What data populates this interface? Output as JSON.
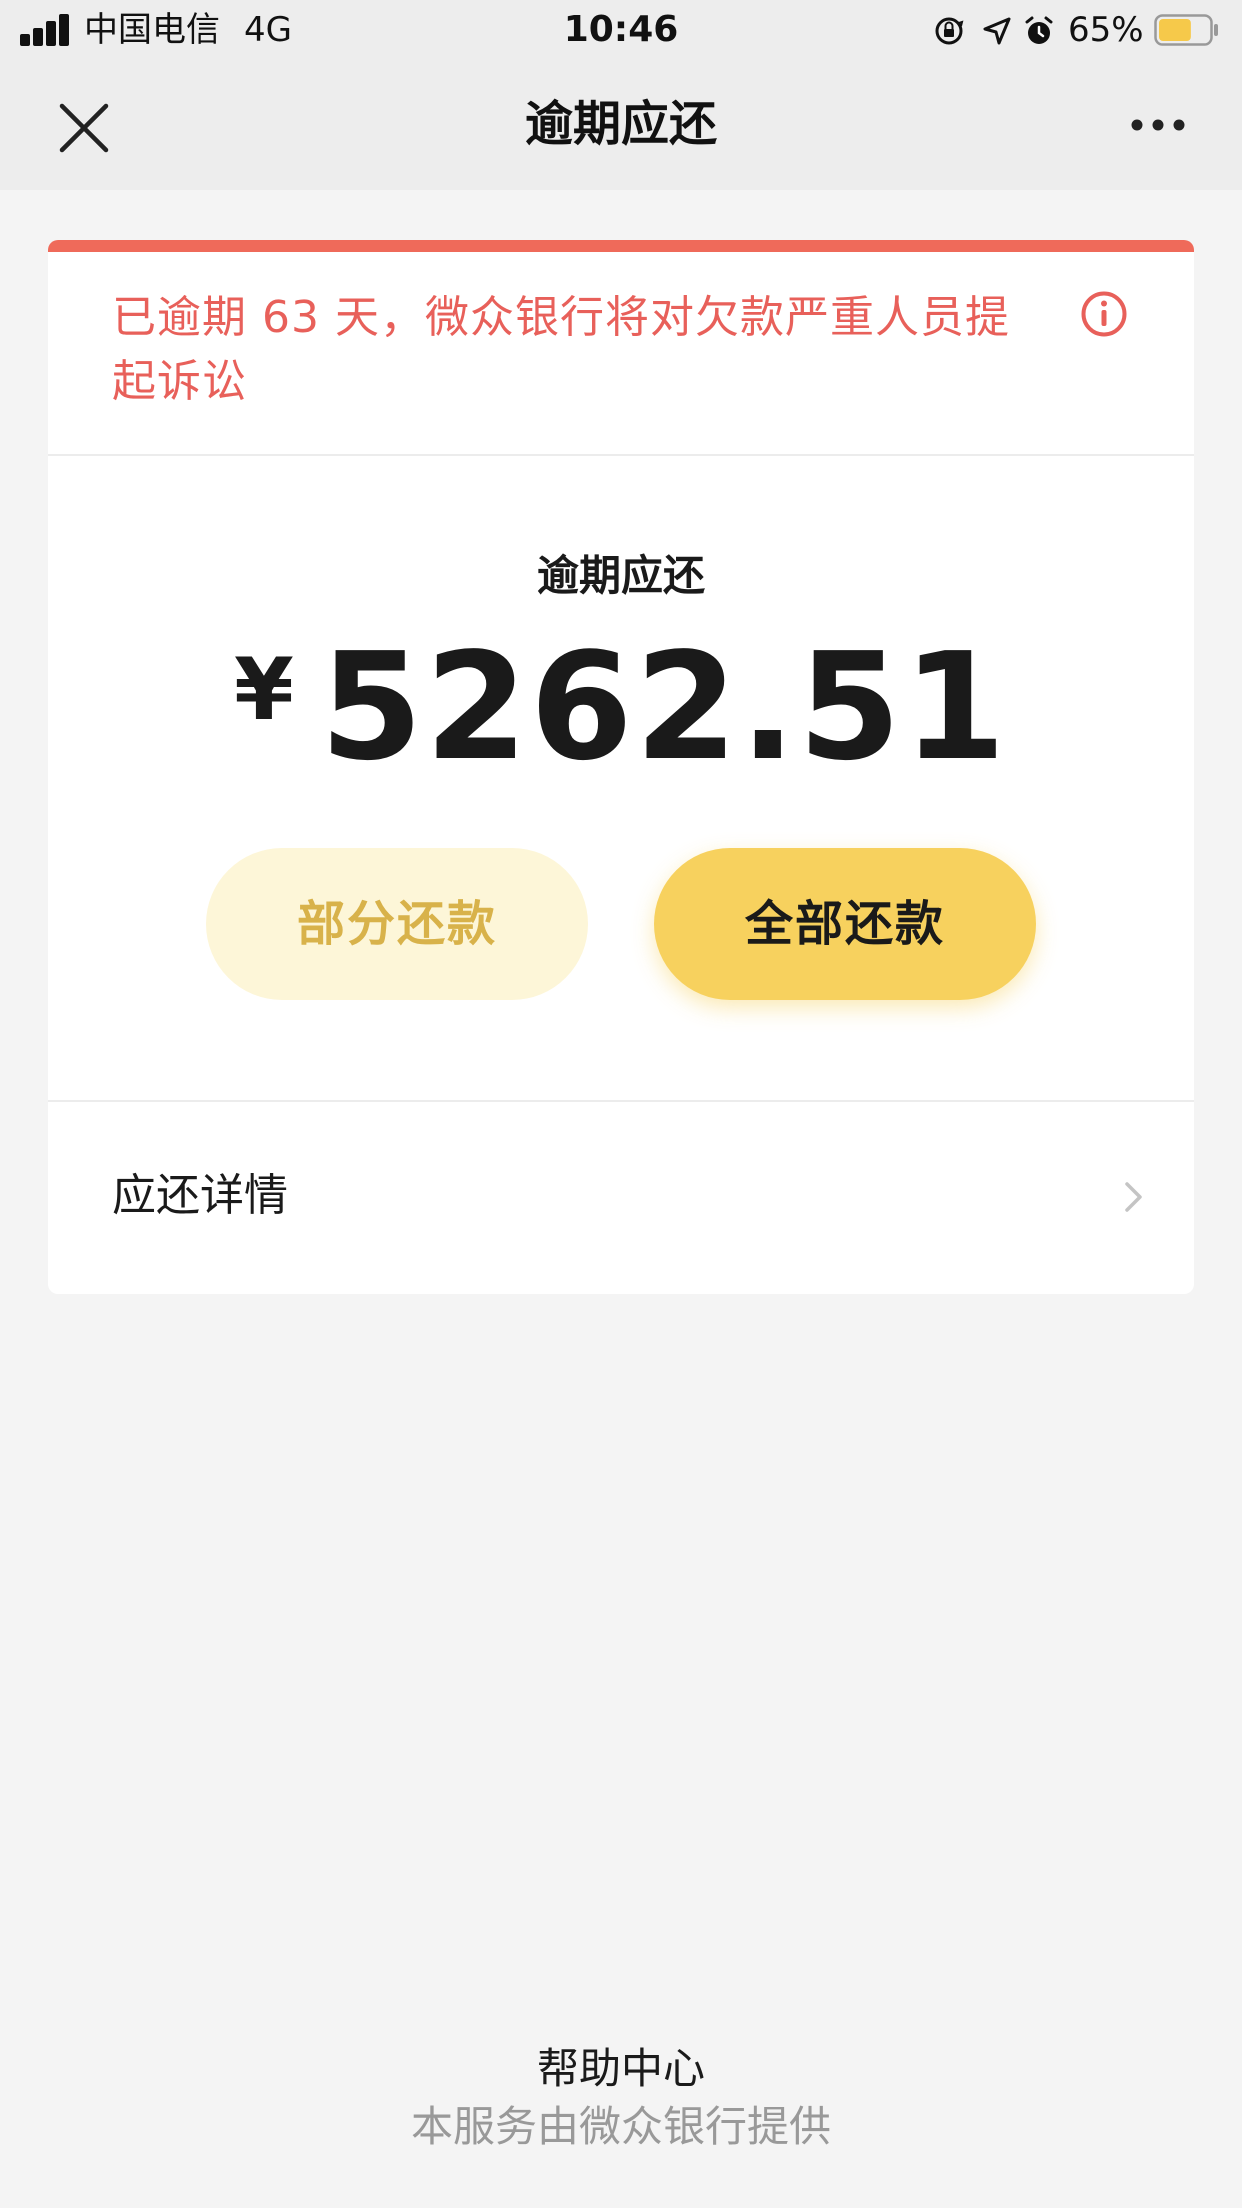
{
  "status_bar": {
    "carrier": "中国电信",
    "network": "4G",
    "time": "10:46",
    "battery_percent": "65%",
    "icons": [
      "signal-icon",
      "orientation-lock-icon",
      "location-icon",
      "alarm-icon",
      "battery-icon"
    ],
    "battery_level": 0.65,
    "battery_color": "#f6c94a"
  },
  "nav": {
    "title": "逾期应还",
    "left_icon": "close-icon",
    "right_icon": "more-icon"
  },
  "notice": {
    "text": "已逾期 63 天，微众银行将对欠款严重人员提起诉讼",
    "icon": "info-icon",
    "color": "#e8605a"
  },
  "amount": {
    "label": "逾期应还",
    "currency": "¥",
    "value": "5262.51"
  },
  "buttons": {
    "partial_label": "部分还款",
    "full_label": "全部还款"
  },
  "detail": {
    "label": "应还详情",
    "icon": "chevron-right-icon"
  },
  "footer": {
    "help": "帮助中心",
    "provider": "本服务由微众银行提供"
  },
  "colors": {
    "accent_yellow": "#f7d15e",
    "light_yellow": "#fdf6d8",
    "alert_red": "#ef6a5a",
    "background": "#f4f4f4"
  }
}
